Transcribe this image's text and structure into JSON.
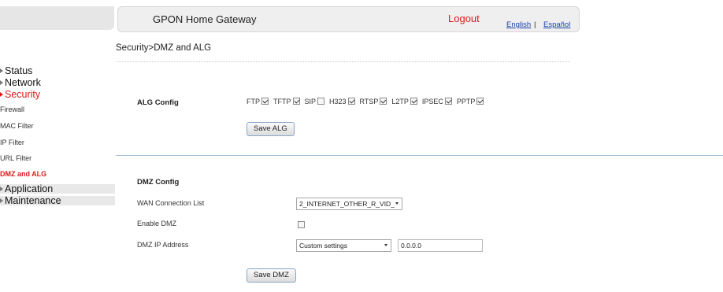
{
  "header": {
    "title": "GPON Home Gateway",
    "logout": "Logout",
    "lang_english": "English",
    "lang_separator": "|",
    "lang_spanish": "Español"
  },
  "sidebar": {
    "status": "Status",
    "network": "Network",
    "security": "Security",
    "security_items": [
      "Firewall",
      "MAC Filter",
      "IP Filter",
      "URL Filter",
      "DMZ and ALG"
    ],
    "application": "Application",
    "maintenance": "Maintenance"
  },
  "breadcrumb": "Security>DMZ and ALG",
  "alg": {
    "title": "ALG Config",
    "items": [
      {
        "label": "FTP",
        "checked": true
      },
      {
        "label": "TFTP",
        "checked": true
      },
      {
        "label": "SIP",
        "checked": false
      },
      {
        "label": "H323",
        "checked": true
      },
      {
        "label": "RTSP",
        "checked": true
      },
      {
        "label": "L2TP",
        "checked": true
      },
      {
        "label": "IPSEC",
        "checked": true
      },
      {
        "label": "PPTP",
        "checked": true
      }
    ],
    "save_label": "Save ALG"
  },
  "dmz": {
    "title": "DMZ Config",
    "wan_label": "WAN Connection List",
    "wan_value": "2_INTERNET_OTHER_R_VID_",
    "enable_label": "Enable DMZ",
    "enable_checked": false,
    "ip_label": "DMZ IP Address",
    "ip_mode": "Custom settings",
    "ip_value": "0.0.0.0",
    "save_label": "Save DMZ"
  }
}
